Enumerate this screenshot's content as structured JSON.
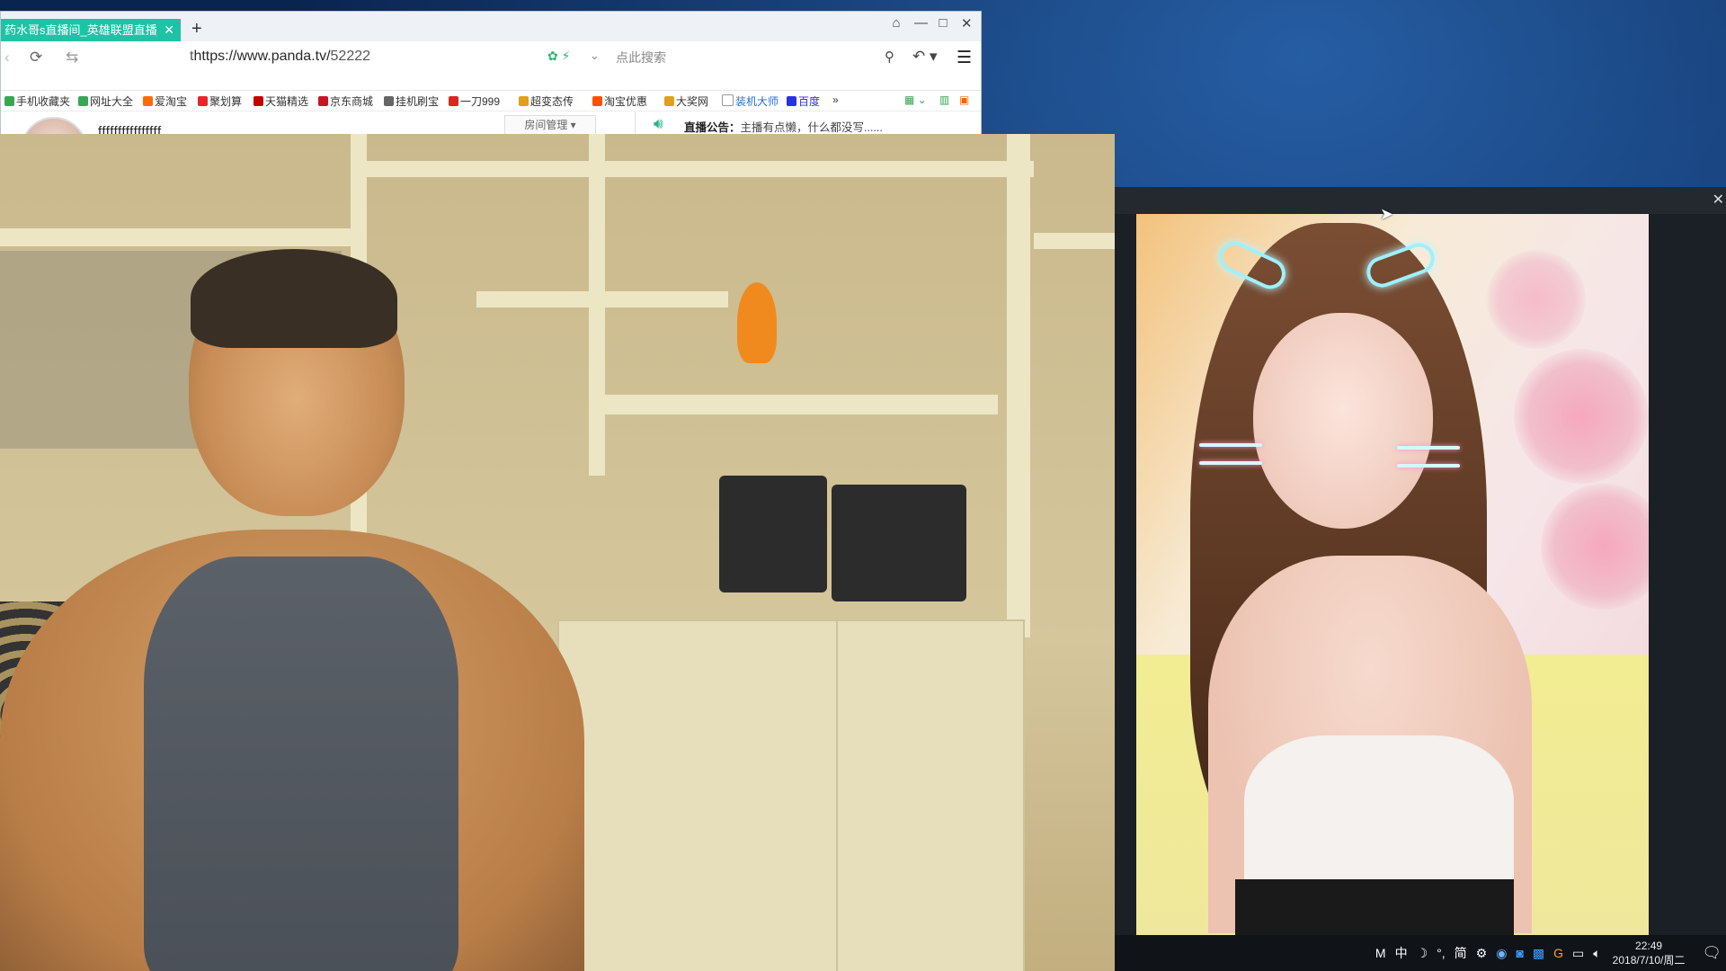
{
  "browser": {
    "tab_title": "药水哥s直播间_英雄联盟直播_lo",
    "tab_close": "✕",
    "new_tab": "+",
    "window_controls": [
      "⌂",
      "—",
      "□",
      "✕"
    ],
    "url_visible_prefix": "t",
    "url_host": "https://www.panda.tv/",
    "url_path": "52222",
    "search_placeholder": "点此搜索",
    "bookmarks": [
      {
        "label": "手机收藏夹",
        "color": "#36a852"
      },
      {
        "label": "网址大全",
        "color": "#36a852"
      },
      {
        "label": "爱淘宝",
        "color": "#ff6a00"
      },
      {
        "label": "聚划算",
        "color": "#e8262a"
      },
      {
        "label": "天猫精选",
        "color": "#c40000"
      },
      {
        "label": "京东商城",
        "color": "#c81623"
      },
      {
        "label": "挂机刷宝",
        "color": "#666666"
      },
      {
        "label": "一刀999",
        "color": "#d9281e"
      },
      {
        "label": "超变态传",
        "color": "#e0a01a"
      },
      {
        "label": "淘宝优惠",
        "color": "#ff5000"
      },
      {
        "label": "大奖网",
        "color": "#e0a01a"
      },
      {
        "label": "装机大师",
        "color": "#2a6fd6"
      },
      {
        "label": "百度",
        "color": "#2932e1"
      }
    ],
    "bookmarks_more": "»"
  },
  "page": {
    "room_name": "ffffffffffffffff",
    "room_mgmt": "房间管理",
    "notice_label": "直播公告：",
    "notice_text": "主播有点懒，什么都没写......"
  },
  "taskbar": {
    "tray_items": [
      "M",
      "中",
      "☽",
      "°,",
      "简",
      "⚙"
    ],
    "time": "22:49",
    "date": "2018/7/10/周二"
  },
  "overlay": {
    "close": "✕"
  }
}
